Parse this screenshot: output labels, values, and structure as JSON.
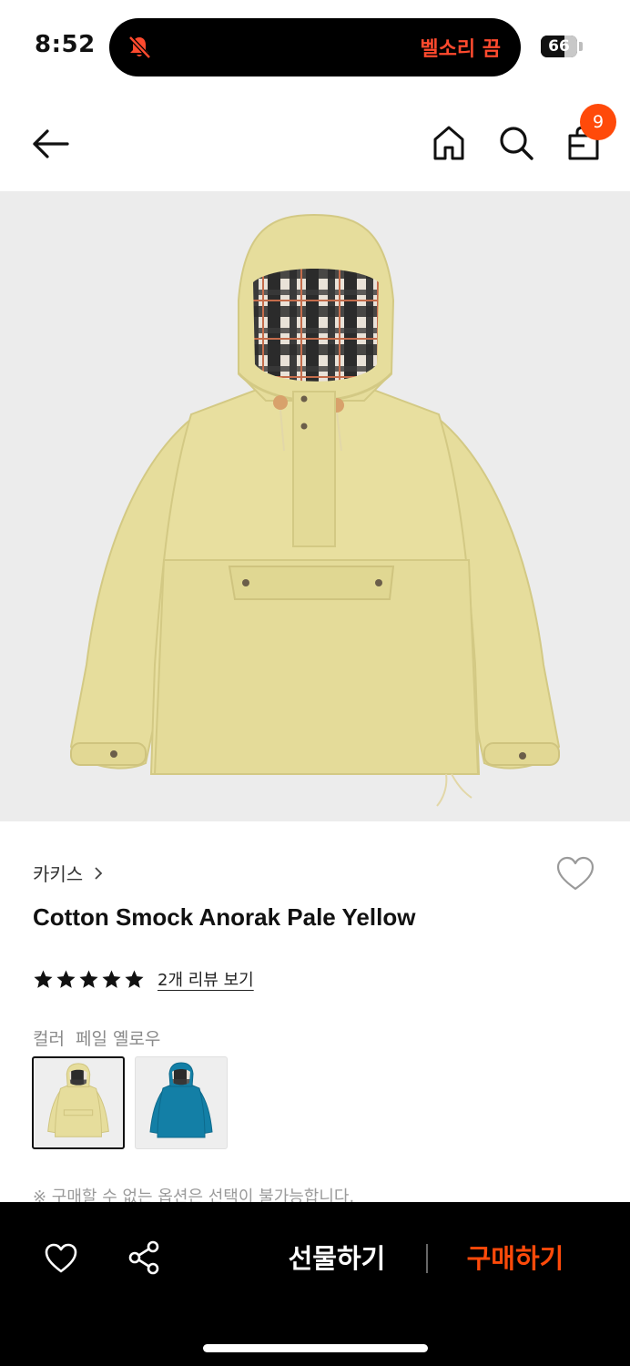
{
  "status_bar": {
    "time": "8:52",
    "silent_label": "벨소리 끔",
    "battery": "66",
    "battery_level": 0.66,
    "accent_color": "#ff4a2e"
  },
  "nav": {
    "back_icon": "arrow-left-icon",
    "home_icon": "home-icon",
    "search_icon": "search-icon",
    "bag_icon": "shopping-bag-icon",
    "cart_badge": "9",
    "badge_color": "#ff4a0a"
  },
  "product": {
    "brand": "카키스",
    "title": "Cotton Smock Anorak Pale Yellow",
    "rating": 5,
    "rating_max": 5,
    "review_link": "2개 리뷰 보기",
    "color_label": "컬러",
    "color_value": "페일 옐로우",
    "swatches": [
      {
        "color": "#e6dd9c",
        "selected": true
      },
      {
        "color": "#137fa6",
        "selected": false
      }
    ],
    "note": "※ 구매할 수 없는 옵션은 선택이 불가능합니다."
  },
  "bottom_bar": {
    "wishlist_icon": "heart-icon",
    "share_icon": "share-icon",
    "gift_label": "선물하기",
    "buy_label": "구매하기",
    "buy_color": "#ff4a0a"
  }
}
